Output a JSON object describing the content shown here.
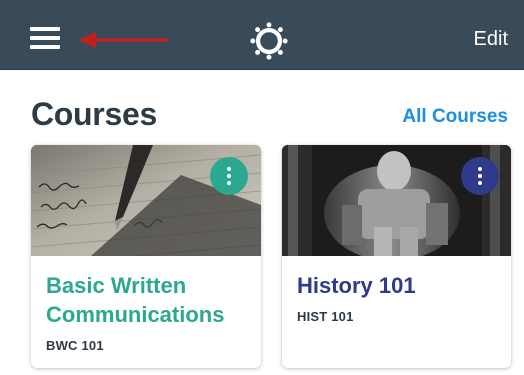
{
  "topbar": {
    "background": "#394b58",
    "menu_icon": "hamburger-menu-icon",
    "logo_icon": "canvas-logo-icon",
    "edit_label": "Edit",
    "annotation_color": "#c0211c"
  },
  "courses": {
    "heading": "Courses",
    "all_courses_label": "All Courses",
    "accent": "#1a8fe3",
    "cards": [
      {
        "title": "Basic Written Communications",
        "code": "BWC 101",
        "color": "#2ba88f",
        "image": "fountain-pen-writing"
      },
      {
        "title": "History 101",
        "code": "HIST 101",
        "color": "#2d3b8a",
        "image": "lincoln-memorial-statue"
      }
    ]
  }
}
